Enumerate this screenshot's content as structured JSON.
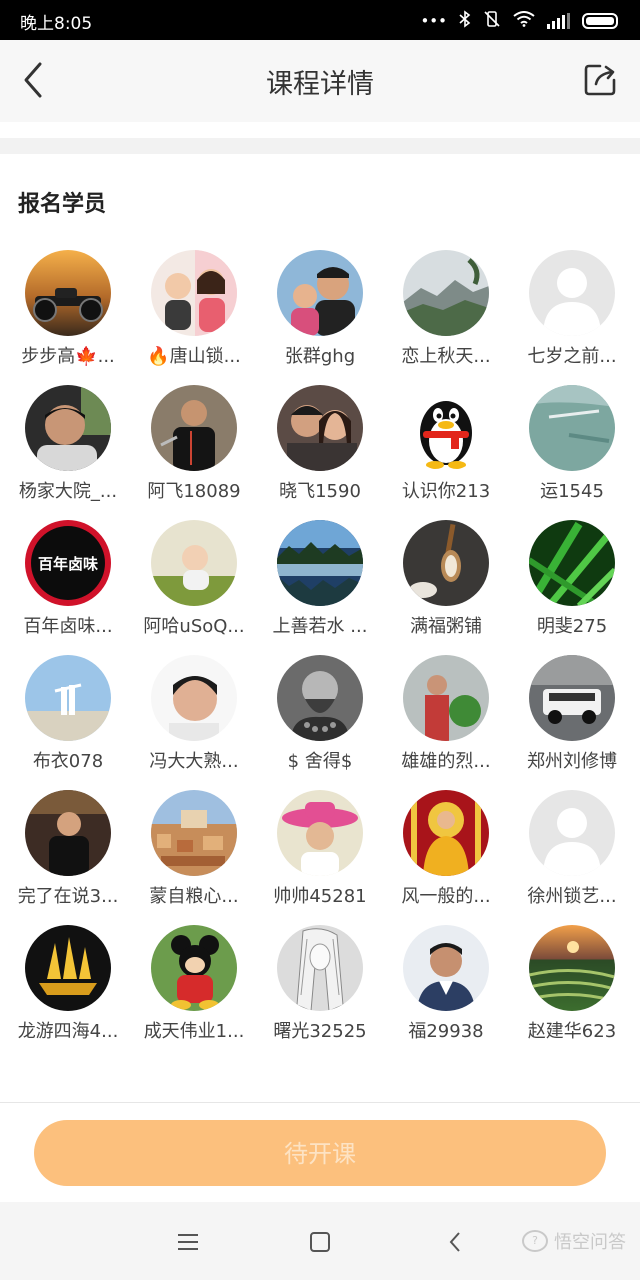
{
  "status_bar": {
    "time": "晚上8:05",
    "icons": [
      "dots-icon",
      "bluetooth-icon",
      "vibrate-off-icon",
      "wifi-icon",
      "signal-icon",
      "battery-icon"
    ]
  },
  "header": {
    "title": "课程详情",
    "back_icon": "chevron-left-icon",
    "share_icon": "share-icon"
  },
  "section": {
    "title": "报名学员"
  },
  "students": [
    {
      "name": "步步高🍁..."
    },
    {
      "name": "🔥唐山锁..."
    },
    {
      "name": "张群ghg"
    },
    {
      "name": "恋上秋天..."
    },
    {
      "name": "七岁之前..."
    },
    {
      "name": "杨家大院_..."
    },
    {
      "name": "阿飞18089"
    },
    {
      "name": "晓飞1590"
    },
    {
      "name": "认识你213"
    },
    {
      "name": "运1545"
    },
    {
      "name": "百年卤味..."
    },
    {
      "name": "阿哈uSoQ..."
    },
    {
      "name": "上善若水 ..."
    },
    {
      "name": "满福粥铺"
    },
    {
      "name": "明斐275"
    },
    {
      "name": "布衣078"
    },
    {
      "name": "冯大大熟..."
    },
    {
      "name": "$ 舍得$"
    },
    {
      "name": "雄雄的烈..."
    },
    {
      "name": "郑州刘修博"
    },
    {
      "name": "完了在说3..."
    },
    {
      "name": "蒙自粮心..."
    },
    {
      "name": "帅帅45281"
    },
    {
      "name": "风一般的..."
    },
    {
      "name": "徐州锁艺..."
    },
    {
      "name": "龙游四海4..."
    },
    {
      "name": "成天伟业1..."
    },
    {
      "name": "曙光32525"
    },
    {
      "name": "福29938"
    },
    {
      "name": "赵建华623"
    }
  ],
  "avatar_art": {
    "baineng_logo_text": "百年卤味"
  },
  "bottom": {
    "button_label": "待开课",
    "button_color": "#fcc07d"
  },
  "nav": {
    "menu_icon": "menu-icon",
    "home_icon": "home-square-icon",
    "back_icon": "back-chevron-icon"
  },
  "watermark": {
    "text": "悟空问答"
  }
}
